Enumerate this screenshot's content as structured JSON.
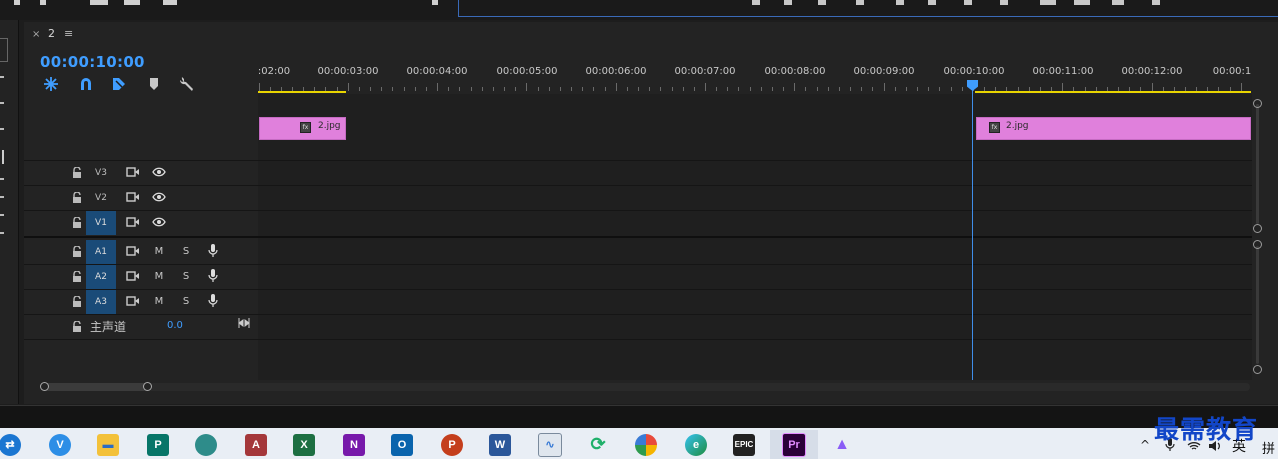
{
  "sequence": {
    "tab_close": "×",
    "name": "2",
    "menu_glyph": "≡",
    "timecode": "00:00:10:00"
  },
  "ruler": {
    "labels": [
      ":02:00",
      "00:00:03:00",
      "00:00:04:00",
      "00:00:05:00",
      "00:00:06:00",
      "00:00:07:00",
      "00:00:08:00",
      "00:00:09:00",
      "00:00:10:00",
      "00:00:11:00",
      "00:00:12:00",
      "00:00:1"
    ]
  },
  "tracks": {
    "video": [
      {
        "label": "V3",
        "targeted": false
      },
      {
        "label": "V2",
        "targeted": false
      },
      {
        "label": "V1",
        "targeted": true
      }
    ],
    "audio": [
      {
        "label": "A1",
        "mute": "M",
        "solo": "S"
      },
      {
        "label": "A2",
        "mute": "M",
        "solo": "S"
      },
      {
        "label": "A3",
        "mute": "M",
        "solo": "S"
      }
    ],
    "master": {
      "label": "主声道",
      "value": "0.0"
    }
  },
  "clips": [
    {
      "name": "2.jpg",
      "fx": "fx"
    },
    {
      "name": "2.jpg",
      "fx": "fx"
    }
  ],
  "colors": {
    "accent": "#3f9dff",
    "clip": "#e080dc",
    "workarea": "#e8d400",
    "track_target": "#1a4b78"
  },
  "taskbar": {
    "apps": [
      {
        "icon": "teamviewer-icon"
      },
      {
        "icon": "vivaldi-icon"
      },
      {
        "icon": "file-explorer-icon"
      },
      {
        "icon": "publisher-icon"
      },
      {
        "icon": "orb-icon"
      },
      {
        "icon": "access-icon"
      },
      {
        "icon": "excel-icon"
      },
      {
        "icon": "onenote-icon"
      },
      {
        "icon": "outlook-icon"
      },
      {
        "icon": "powerpoint-icon"
      },
      {
        "icon": "word-icon"
      },
      {
        "icon": "resource-monitor-icon"
      },
      {
        "icon": "sync-icon"
      },
      {
        "icon": "pinwheel-icon"
      },
      {
        "icon": "edge-icon"
      },
      {
        "icon": "epic-games-icon"
      },
      {
        "icon": "premiere-icon"
      },
      {
        "icon": "photos-icon"
      }
    ],
    "epic_text": "EPIC",
    "pr_text": "Pr",
    "ime": "英",
    "ime2": "拼"
  },
  "watermark": "最需教育"
}
